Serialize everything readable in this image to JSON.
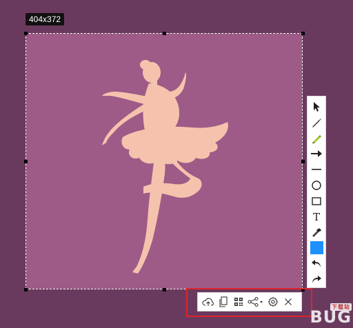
{
  "colors": {
    "dim_overlay": "#6a3a5e",
    "selection_fill": "#9e5b87",
    "dancer": "#f5c3ad",
    "accent_swatch": "#1e90ff",
    "highlight_frame": "#e0232c"
  },
  "selection": {
    "size_label": "404x372",
    "subject": "ballerina silhouette"
  },
  "side_toolbar": {
    "tools": [
      {
        "name": "select",
        "icon": "cursor-icon"
      },
      {
        "name": "pen",
        "icon": "pen-icon"
      },
      {
        "name": "highlighter",
        "icon": "highlighter-icon"
      },
      {
        "name": "arrow",
        "icon": "arrow-icon"
      },
      {
        "name": "line",
        "icon": "line-icon"
      },
      {
        "name": "ellipse",
        "icon": "circle-icon"
      },
      {
        "name": "rectangle",
        "icon": "rectangle-icon"
      },
      {
        "name": "text",
        "icon": "text-icon",
        "glyph": "T"
      },
      {
        "name": "color-picker",
        "icon": "eyedropper-icon"
      },
      {
        "name": "color",
        "icon": "color-swatch"
      },
      {
        "name": "undo",
        "icon": "undo-icon"
      },
      {
        "name": "redo",
        "icon": "redo-icon"
      }
    ]
  },
  "bottom_toolbar": {
    "tools": [
      {
        "name": "upload",
        "icon": "cloud-upload-icon"
      },
      {
        "name": "copy",
        "icon": "copy-icon"
      },
      {
        "name": "qr-code",
        "icon": "qr-code-icon"
      },
      {
        "name": "share",
        "icon": "share-icon"
      },
      {
        "name": "settings",
        "icon": "gear-icon"
      },
      {
        "name": "close",
        "icon": "close-icon"
      }
    ]
  },
  "watermark": {
    "text": "BUG",
    "sub": "下载站"
  }
}
